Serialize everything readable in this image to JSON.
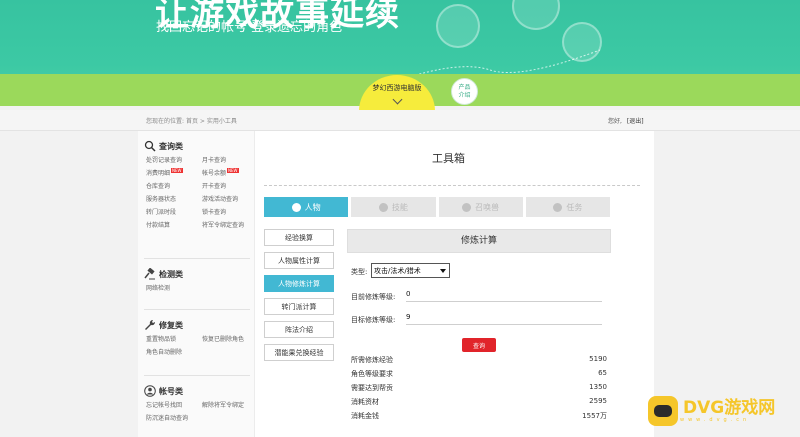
{
  "banner": {
    "hero_title": "让游戏故事延续",
    "subtitle": "找回忘记的帐号  登录遗忘的角色",
    "game_badge": "梦幻西游电脑版",
    "product_intro_line1": "产品",
    "product_intro_line2": "介绍"
  },
  "topbar": {
    "breadcrumb_prefix": "您现在的位置:",
    "breadcrumb_home": "首页",
    "breadcrumb_sep": " > ",
    "breadcrumb_current": "实用小工具",
    "user_greeting": "您好,",
    "logout_label": "[退出]"
  },
  "sidebar": {
    "groups": [
      {
        "title": "查询类",
        "icon": "magnifier-icon",
        "items": [
          "处罚记录查询",
          "月卡查询",
          "消费明细",
          "帐号余额",
          "仓库查询",
          "开卡查询",
          "服务器状态",
          "游戏活动查询",
          "转门派时段",
          "锁卡查询",
          "付款结算",
          "将军令绑定查询"
        ]
      },
      {
        "title": "检测类",
        "icon": "gavel-icon",
        "items": [
          "网络检测"
        ]
      },
      {
        "title": "修复类",
        "icon": "wrench-icon",
        "items": [
          "重置物品锁",
          "恢复已删除角色",
          "角色自动删除"
        ]
      },
      {
        "title": "帐号类",
        "icon": "user-icon",
        "items": [
          "忘记帐号找回",
          "解除将军令绑定",
          "防沉迷自动查询"
        ]
      }
    ],
    "new_tag": "NEW"
  },
  "main": {
    "title": "工具箱",
    "tabs": [
      {
        "label": "人物",
        "icon": "person-icon",
        "active": true
      },
      {
        "label": "技能",
        "icon": "skill-icon",
        "active": false
      },
      {
        "label": "召唤兽",
        "icon": "summon-icon",
        "active": false
      },
      {
        "label": "任务",
        "icon": "task-icon",
        "active": false
      }
    ],
    "subnav": [
      {
        "label": "经验换算",
        "active": false
      },
      {
        "label": "人物属性计算",
        "active": false
      },
      {
        "label": "人物修炼计算",
        "active": true
      },
      {
        "label": "转门派计算",
        "active": false
      },
      {
        "label": "阵法介绍",
        "active": false
      },
      {
        "label": "潜能果兑换经验",
        "active": false
      }
    ],
    "panel": {
      "heading": "修炼计算",
      "type_label": "类型:",
      "type_value": "攻击/法术/猎术",
      "current_label": "目前修炼等级:",
      "current_value": "0",
      "target_label": "目标修炼等级:",
      "target_value": "9",
      "query_button": "查询",
      "results": [
        {
          "label": "所需修炼经验",
          "value": "5190"
        },
        {
          "label": "角色等级要求",
          "value": "65"
        },
        {
          "label": "需要达到帮贡",
          "value": "1350"
        },
        {
          "label": "消耗资材",
          "value": "2595"
        },
        {
          "label": "消耗金钱",
          "value": "1557万"
        }
      ]
    }
  },
  "watermark": {
    "text": "DVG游戏网",
    "sub": "www.dvg.cn"
  },
  "colors": {
    "accent": "#42b8d3",
    "banner": "#3cc9a4",
    "query": "#e1242a",
    "badge": "#f6ec3c"
  }
}
